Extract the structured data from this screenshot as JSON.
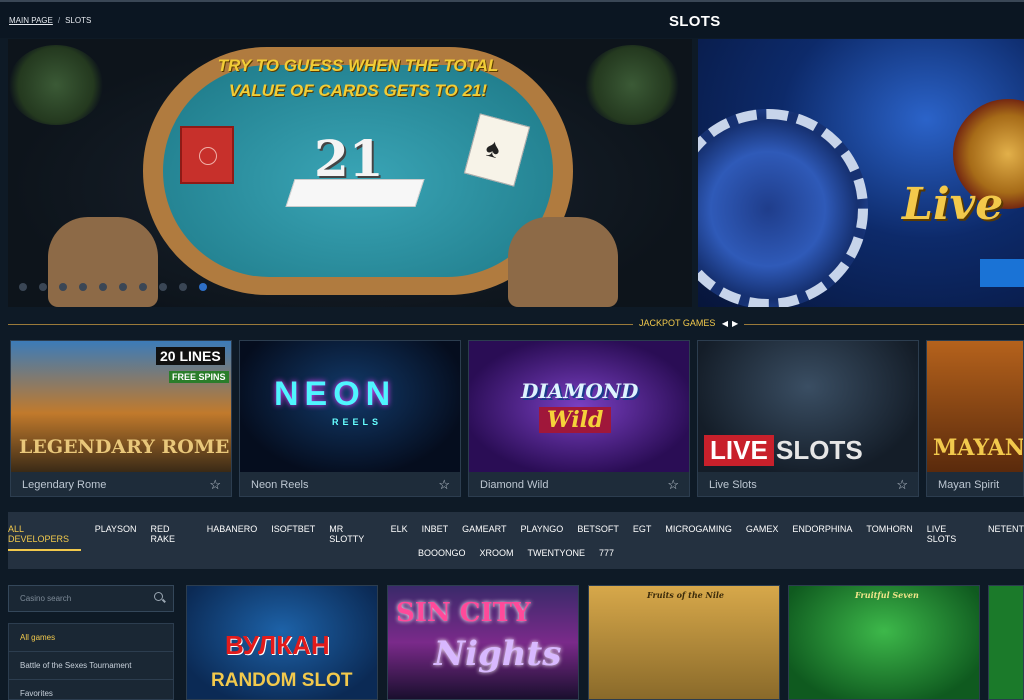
{
  "header": {
    "breadcrumb": [
      "MAIN PAGE",
      "SLOTS"
    ],
    "title": "SLOTS"
  },
  "banner": {
    "headline": "TRY TO GUESS WHEN THE TOTAL VALUE OF CARDS GETS TO 21!",
    "score": "21",
    "live_text": "Live",
    "slide_count": 10,
    "active_slide": 10
  },
  "jackpot": {
    "title": "JACKPOT GAMES",
    "games": [
      {
        "name": "Legendary Rome",
        "art": "LEGENDARY ROME",
        "badge": "20 LINES",
        "badge2": "FREE SPINS"
      },
      {
        "name": "Neon Reels",
        "art": "NEON",
        "art2": "REELS"
      },
      {
        "name": "Diamond Wild",
        "art": "DIAMOND",
        "art2": "Wild"
      },
      {
        "name": "Live Slots",
        "art": "LIVE",
        "art2": "SLOTS"
      },
      {
        "name": "Mayan Spirit",
        "art": "MAYAN"
      }
    ]
  },
  "developers": {
    "row1": [
      "ALL DEVELOPERS",
      "PLAYSON",
      "RED RAKE",
      "HABANERO",
      "ISOFTBET",
      "MR SLOTTY",
      "ELK",
      "INBET",
      "GAMEART",
      "PLAYNGO",
      "BETSOFT",
      "EGT",
      "MICROGAMING",
      "GAMEX",
      "ENDORPHINA",
      "TOMHORN",
      "LIVE SLOTS",
      "NETENT"
    ],
    "row2": [
      "BOOONGO",
      "XROOM",
      "TWENTYONE",
      "777"
    ]
  },
  "search": {
    "placeholder": "Casino search"
  },
  "sidebar": {
    "items": [
      "All games",
      "Battle of the Sexes Tournament",
      "Favorites"
    ]
  },
  "tiles": [
    {
      "title": "ВУЛКАН",
      "subtitle": "RANDOM SLOT"
    },
    {
      "title": "SIN CITY",
      "subtitle": "Nights"
    },
    {
      "title": "Fruits of the Nile"
    },
    {
      "title": "Fruitful Seven"
    }
  ],
  "colors": {
    "accent": "#f2c94c",
    "background": "#0e1a26",
    "panel": "#243140"
  }
}
